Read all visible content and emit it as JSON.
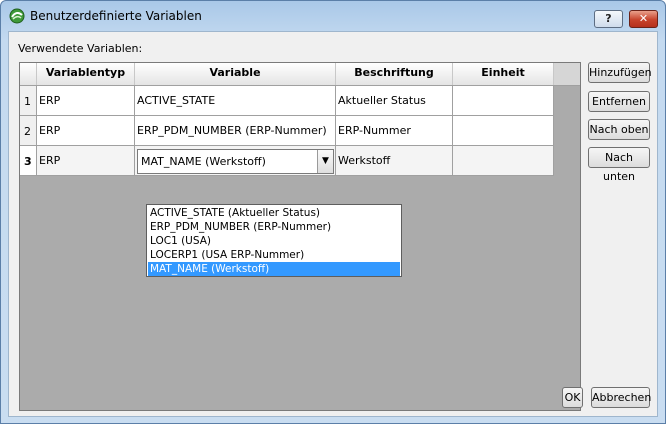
{
  "window": {
    "title": "Benutzerdefinierte Variablen",
    "help_label": "?",
    "close_label": "✕"
  },
  "section_label": "Verwendete Variablen:",
  "table": {
    "columns": [
      "Variablentyp",
      "Variable",
      "Beschriftung",
      "Einheit"
    ],
    "rows": [
      {
        "num": "1",
        "typ": "ERP",
        "variable": "ACTIVE_STATE",
        "beschriftung": "Aktueller Status",
        "einheit": ""
      },
      {
        "num": "2",
        "typ": "ERP",
        "variable": "ERP_PDM_NUMBER (ERP-Nummer)",
        "beschriftung": "ERP-Nummer",
        "einheit": ""
      },
      {
        "num": "3",
        "typ": "ERP",
        "variable": "MAT_NAME (Werkstoff)",
        "beschriftung": "Werkstoff",
        "einheit": ""
      }
    ]
  },
  "dropdown": {
    "options": [
      "ACTIVE_STATE (Aktueller Status)",
      "ERP_PDM_NUMBER (ERP-Nummer)",
      "LOC1 (USA)",
      "LOCERP1 (USA ERP-Nummer)",
      "MAT_NAME (Werkstoff)"
    ],
    "selected_index": 4
  },
  "buttons": {
    "add": "Hinzufügen",
    "remove": "Entfernen",
    "up": "Nach oben",
    "down": "Nach unten",
    "ok": "OK",
    "cancel": "Abbrechen"
  },
  "colors": {
    "selection": "#3399ff",
    "title_bar": "#c4daf0",
    "close_button": "#c7432c"
  },
  "icons": {
    "app": "solidworks-pdm-icon",
    "dropdown": "chevron-down-icon"
  }
}
